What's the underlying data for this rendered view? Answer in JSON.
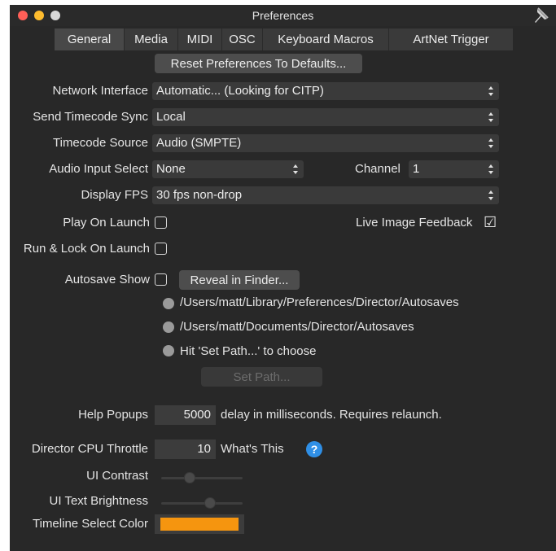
{
  "window": {
    "title": "Preferences"
  },
  "colors": {
    "accent_swatch": "#f5950f",
    "help_icon": "#2f8fe6",
    "close": "#ff5f57",
    "minimize": "#febc2e",
    "zoom": "#d9d9d9"
  },
  "tabs": [
    {
      "label": "General",
      "active": true
    },
    {
      "label": "Media"
    },
    {
      "label": "MIDI"
    },
    {
      "label": "OSC"
    },
    {
      "label": "Keyboard Macros"
    },
    {
      "label": "ArtNet Trigger"
    }
  ],
  "reset_button": "Reset Preferences To Defaults...",
  "network_interface": {
    "label": "Network Interface",
    "value": "Automatic... (Looking for CITP)"
  },
  "send_timecode_sync": {
    "label": "Send Timecode Sync",
    "value": "Local"
  },
  "timecode_source": {
    "label": "Timecode Source",
    "value": "Audio (SMPTE)"
  },
  "audio_input_select": {
    "label": "Audio Input Select",
    "value": "None"
  },
  "channel": {
    "label": "Channel",
    "value": "1"
  },
  "display_fps": {
    "label": "Display FPS",
    "value": "30 fps non-drop"
  },
  "play_on_launch": {
    "label": "Play On Launch",
    "checked": false
  },
  "live_image_feedback": {
    "label": "Live Image Feedback",
    "checked": true,
    "check_glyph": "☑"
  },
  "run_lock_on_launch": {
    "label": "Run & Lock On Launch",
    "checked": false
  },
  "autosave_show": {
    "label": "Autosave Show",
    "checked": false
  },
  "reveal_in_finder": "Reveal in Finder...",
  "autosave_paths": [
    "/Users/matt/Library/Preferences/Director/Autosaves",
    "/Users/matt/Documents/Director/Autosaves",
    "Hit 'Set Path...' to choose"
  ],
  "set_path_button": "Set Path...",
  "help_popups": {
    "label": "Help Popups",
    "value": "5000",
    "note": "delay in milliseconds.  Requires relaunch."
  },
  "cpu_throttle": {
    "label": "Director CPU Throttle",
    "value": "10",
    "note": "What's This",
    "help_glyph": "?"
  },
  "ui_contrast": {
    "label": "UI Contrast",
    "level": 0.35
  },
  "ui_text_brightness": {
    "label": "UI Text Brightness",
    "level": 0.6
  },
  "timeline_select_color": {
    "label": "Timeline Select Color",
    "color": "#f5950f"
  }
}
